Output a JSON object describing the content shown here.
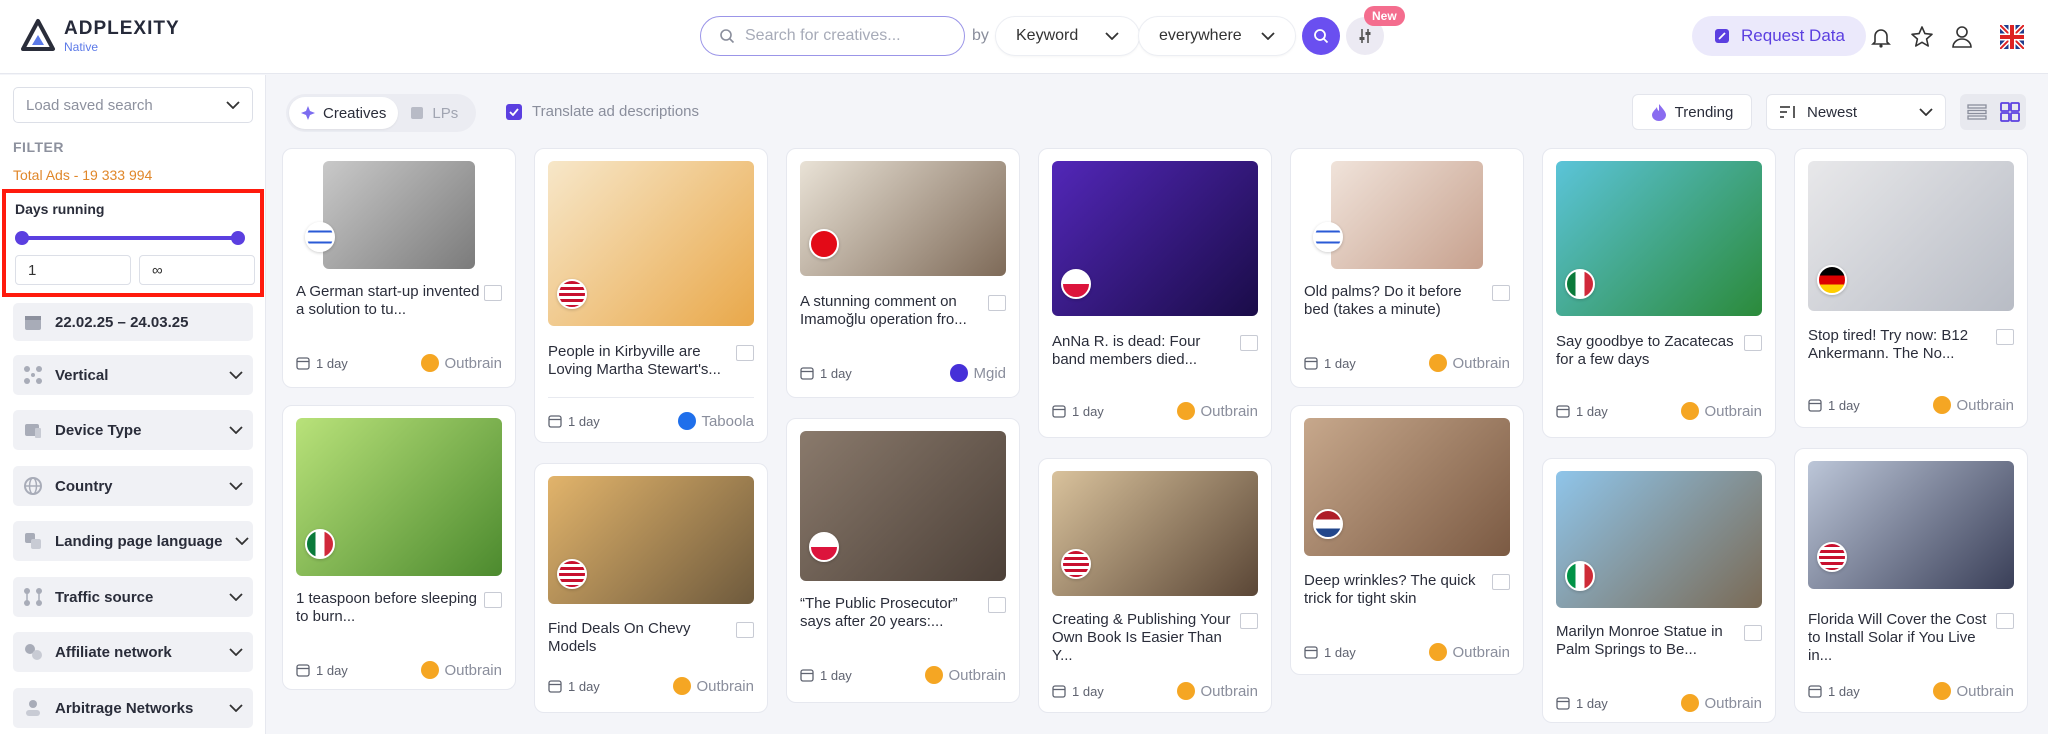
{
  "brand": {
    "name": "ADPLEXITY",
    "sub": "Native"
  },
  "search": {
    "placeholder": "Search for creatives...",
    "by": "by",
    "keyword": "Keyword",
    "where": "everywhere",
    "new_badge": "New"
  },
  "header": {
    "request_data": "Request Data"
  },
  "sidebar": {
    "saved_search_placeholder": "Load saved search",
    "filter_title": "FILTER",
    "total_ads": "Total Ads - 19 333 994",
    "days_running": {
      "title": "Days running",
      "min": "1",
      "max": "∞"
    },
    "date_range": "22.02.25 – 24.03.25",
    "items": [
      {
        "label": "Vertical",
        "icon": "vertical-icon"
      },
      {
        "label": "Device Type",
        "icon": "device-icon"
      },
      {
        "label": "Country",
        "icon": "globe-icon"
      },
      {
        "label": "Landing page language",
        "icon": "language-icon"
      },
      {
        "label": "Traffic source",
        "icon": "traffic-icon"
      },
      {
        "label": "Affiliate network",
        "icon": "network-icon"
      },
      {
        "label": "Arbitrage Networks",
        "icon": "arbitrage-icon"
      }
    ]
  },
  "toolbar": {
    "tab_creatives": "Creatives",
    "tab_lps": "LPs",
    "translate": "Translate ad descriptions",
    "trending": "Trending",
    "sort": "Newest"
  },
  "cards": [
    {
      "title": "A German start-up invented a solution to tu...",
      "days": "1 day",
      "network": "Outbrain",
      "flag": "Israel"
    },
    {
      "title": "1 teaspoon before sleeping to burn...",
      "days": "1 day",
      "network": "Outbrain",
      "flag": "Mexico"
    },
    {
      "title": "People in Kirbyville are Loving Martha Stewart's...",
      "days": "1 day",
      "network": "Taboola",
      "flag": "USA"
    },
    {
      "title": "Find Deals On Chevy Models",
      "days": "1 day",
      "network": "Outbrain",
      "flag": "USA"
    },
    {
      "title": "A stunning comment on Imamoğlu operation fro...",
      "days": "1 day",
      "network": "Mgid",
      "flag": "Turkey"
    },
    {
      "title": "“The Public Prosecutor” says after 20 years:...",
      "days": "1 day",
      "network": "Outbrain",
      "flag": "Poland"
    },
    {
      "title": "AnNa R. is dead: Four band members died...",
      "days": "1 day",
      "network": "Outbrain",
      "flag": "Poland"
    },
    {
      "title": "Creating & Publishing Your Own Book Is Easier Than Y...",
      "days": "1 day",
      "network": "Outbrain",
      "flag": "USA"
    },
    {
      "title": "Old palms? Do it before bed (takes a minute)",
      "days": "1 day",
      "network": "Outbrain",
      "flag": "Israel"
    },
    {
      "title": "Deep wrinkles? The quick trick for tight skin",
      "days": "1 day",
      "network": "Outbrain",
      "flag": "Netherlands"
    },
    {
      "title": "Say goodbye to Zacatecas for a few days",
      "days": "1 day",
      "network": "Outbrain",
      "flag": "Mexico"
    },
    {
      "title": "Marilyn Monroe Statue in Palm Springs to Be...",
      "days": "1 day",
      "network": "Outbrain",
      "flag": "Italy"
    },
    {
      "title": "Stop tired! Try now: B12 Ankermann. The No...",
      "days": "1 day",
      "network": "Outbrain",
      "flag": "Germany"
    },
    {
      "title": "Florida Will Cover the Cost to Install Solar if You Live in...",
      "days": "1 day",
      "network": "Outbrain",
      "flag": "USA"
    }
  ],
  "colors": {
    "accent": "#5b3fe0",
    "orange": "#e0872a",
    "highlight": "#ff1a0d"
  }
}
